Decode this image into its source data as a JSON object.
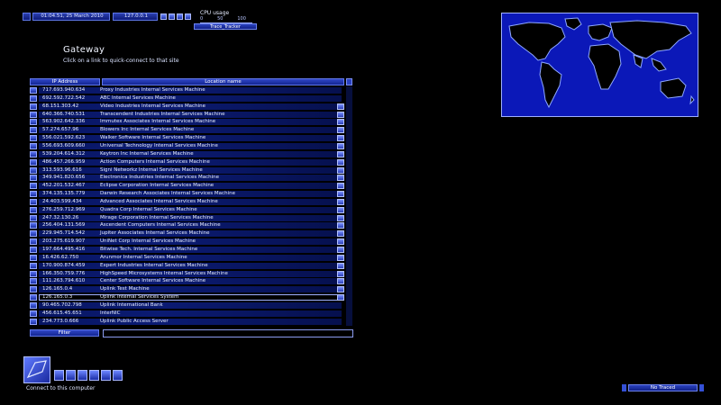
{
  "status_bar": {
    "datetime": "01:04.51, 25 March 2010",
    "ip": "127.0.0.1",
    "cpu_label": "CPU usage",
    "cpu_scale": "0          50          100",
    "trace_tracker": "Trace_Tracker"
  },
  "gateway": {
    "title": "Gateway",
    "subtitle": "Click on a link to quick-connect to that site"
  },
  "table": {
    "col_ip": "IP Address",
    "col_name": "Location name",
    "rows": [
      {
        "ip": "717.693.940.634",
        "name": "Proxy Industries Internal Services Machine"
      },
      {
        "ip": "692.592.722.542",
        "name": "ABC Internal Services Machine"
      },
      {
        "ip": "68.151.303.42",
        "name": "Video Industries Internal Services Machine"
      },
      {
        "ip": "640.366.740.531",
        "name": "Transcendent Industries Internal Services Machine"
      },
      {
        "ip": "563.902.642.336",
        "name": "Immutex Associates Internal Services Machine"
      },
      {
        "ip": "57.274.657.96",
        "name": "Blowers Inc Internal Services Machine"
      },
      {
        "ip": "556.021.592.623",
        "name": "Walker Software Internal Services Machine"
      },
      {
        "ip": "556.693.609.660",
        "name": "Universal Technology Internal Services Machine"
      },
      {
        "ip": "539.204.614.312",
        "name": "Keytron Inc Internal Services Machine"
      },
      {
        "ip": "486.457.266.959",
        "name": "Action Computers Internal Services Machine"
      },
      {
        "ip": "313.593.96.616",
        "name": "Signi Networkz Internal Services Machine"
      },
      {
        "ip": "349.941.820.656",
        "name": "Electronica Industries Internal Services Machine"
      },
      {
        "ip": "452.201.532.467",
        "name": "Eclipse Corporation Internal Services Machine"
      },
      {
        "ip": "374.135.135.779",
        "name": "Darwin Research Associates Internal Services Machine"
      },
      {
        "ip": "24.403.599.434",
        "name": "Advanced Associates Internal Services Machine"
      },
      {
        "ip": "276.259.712.969",
        "name": "Quadra Corp Internal Services Machine"
      },
      {
        "ip": "247.32.130.26",
        "name": "Mirage Corporation Internal Services Machine"
      },
      {
        "ip": "256.404.131.569",
        "name": "Ascendent Computers Internal Services Machine"
      },
      {
        "ip": "229.945.714.542",
        "name": "Jupiter Associates Internal Services Machine"
      },
      {
        "ip": "203.275.619.907",
        "name": "UniNet Corp Internal Services Machine"
      },
      {
        "ip": "197.664.495.416",
        "name": "Bitwise Tech. Internal Services Machine"
      },
      {
        "ip": "16.426.62.750",
        "name": "Arunmor Internal Services Machine"
      },
      {
        "ip": "170.900.874.459",
        "name": "Expert Industries Internal Services Machine"
      },
      {
        "ip": "166.350.759.776",
        "name": "HighSpeed Microsystems Internal Services Machine"
      },
      {
        "ip": "111.263.794.610",
        "name": "Center Software Internal Services Machine"
      },
      {
        "ip": "126.165.0.4",
        "name": "Uplink Test Machine"
      },
      {
        "ip": "126.165.0.3",
        "name": "Uplink Internal Services System"
      },
      {
        "ip": "90.465.702.798",
        "name": "Uplink International Bank"
      },
      {
        "ip": "456.615.45.651",
        "name": "InterNIC"
      },
      {
        "ip": "234.773.0.666",
        "name": "Uplink Public Access Server"
      }
    ]
  },
  "filter": {
    "label": "Filter",
    "value": ""
  },
  "bottom": {
    "connect_text": "Connect to this computer",
    "traced": "No Traced"
  },
  "colors": {
    "accent": "#1a2fa3",
    "map_ocean": "#0b18b8",
    "map_land": "#000000",
    "map_outline": "#7f9cff"
  },
  "icons": [
    "tool-icon-1",
    "tool-icon-2",
    "tool-icon-3",
    "tool-icon-4",
    "gateway-computer-icon",
    "small-tool-icons"
  ]
}
